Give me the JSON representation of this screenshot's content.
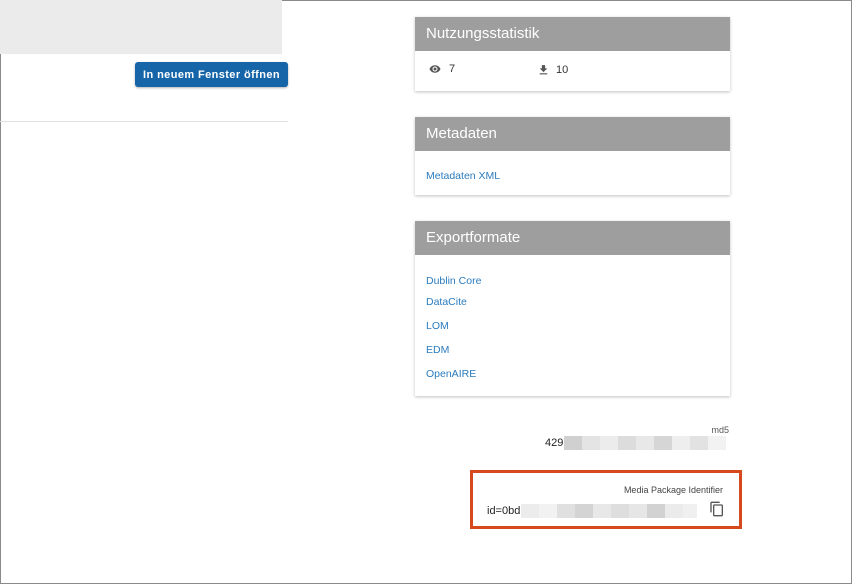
{
  "left": {
    "open_button_label": "In neuem Fenster öffnen"
  },
  "usage_card": {
    "title": "Nutzungsstatistik",
    "views_icon": "eye-icon",
    "views": "7",
    "downloads_icon": "download-icon",
    "downloads": "10"
  },
  "metadata_card": {
    "title": "Metadaten",
    "link": "Metadaten XML"
  },
  "export_card": {
    "title": "Exportformate",
    "links": [
      "Dublin Core",
      "DataCite",
      "LOM",
      "EDM",
      "OpenAIRE"
    ]
  },
  "md5": {
    "label": "md5",
    "value_prefix": "429"
  },
  "media_package": {
    "label": "Media Package Identifier",
    "value_prefix": "id=0bd",
    "copy_icon": "copy-icon"
  },
  "colors": {
    "accent": "#1565a8",
    "card_header": "#9e9e9e",
    "link": "#2b7bbd",
    "highlight": "#d6491c"
  }
}
